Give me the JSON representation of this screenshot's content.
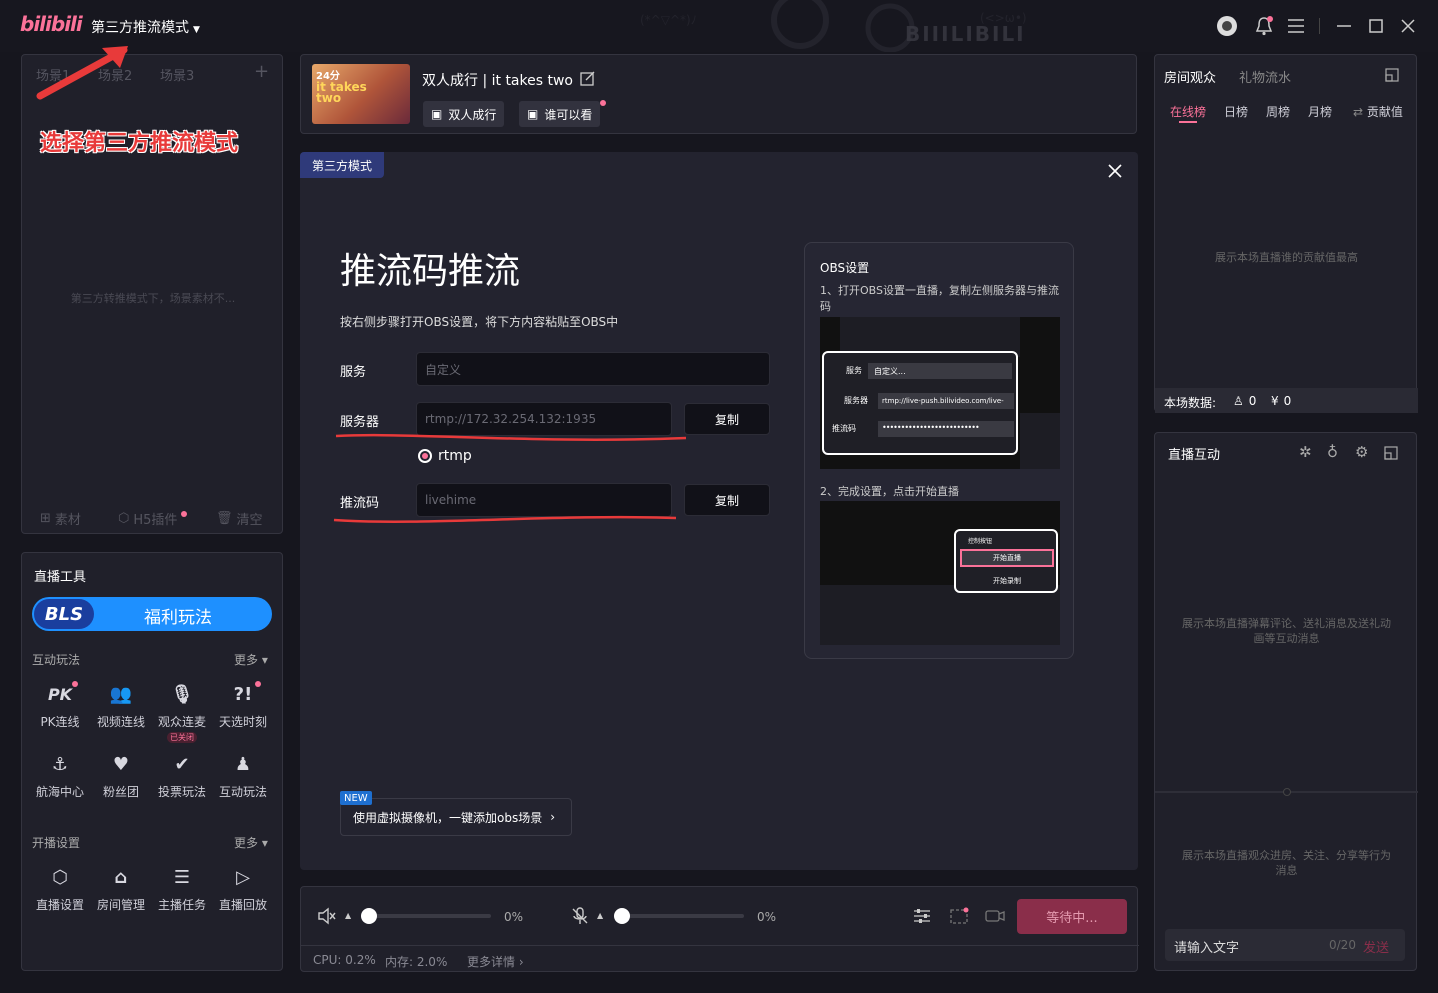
{
  "titlebar": {
    "logo": "bilibili",
    "mode_label": "第三方推流模式",
    "watermark": "BIIILIBILI"
  },
  "annotation": {
    "text": "选择第三方推流模式",
    "color": "#e83a3a"
  },
  "scenes": {
    "tabs": [
      "场景1",
      "场景2",
      "场景3"
    ],
    "add_label": "+",
    "empty_text": "第三方转推模式下，场景素材不...",
    "footer": {
      "material": "素材",
      "h5": "H5插件",
      "clear": "清空"
    }
  },
  "tools": {
    "title": "直播工具",
    "banner": {
      "brand": "BLS",
      "label": "福利玩法"
    },
    "interactive": {
      "title": "互动玩法",
      "more": "更多",
      "items": [
        {
          "label": "PK连线",
          "icon": "pk-icon"
        },
        {
          "label": "视频连线",
          "icon": "video-link-icon"
        },
        {
          "label": "观众连麦",
          "icon": "mic-icon",
          "badge": "已关闭"
        },
        {
          "label": "天选时刻",
          "icon": "lottery-icon"
        },
        {
          "label": "航海中心",
          "icon": "anchor-icon"
        },
        {
          "label": "粉丝团",
          "icon": "fans-icon"
        },
        {
          "label": "投票玩法",
          "icon": "vote-icon"
        },
        {
          "label": "互动玩法",
          "icon": "interactive-icon"
        }
      ]
    },
    "broadcast": {
      "title": "开播设置",
      "more": "更多",
      "items": [
        {
          "label": "直播设置",
          "icon": "settings-icon"
        },
        {
          "label": "房间管理",
          "icon": "room-icon"
        },
        {
          "label": "主播任务",
          "icon": "task-icon"
        },
        {
          "label": "直播回放",
          "icon": "replay-icon"
        }
      ]
    }
  },
  "game": {
    "thumb_tag": "24分",
    "thumb_title": "it takes two",
    "title": "双人成行 | it takes two",
    "category": "双人成行",
    "visibility": "谁可以看"
  },
  "modal": {
    "tag": "第三方模式",
    "title": "推流码推流",
    "description": "按右侧步骤打开OBS设置，将下方内容粘贴至OBS中",
    "service": {
      "label": "服务",
      "value": "自定义"
    },
    "server": {
      "label": "服务器",
      "value": "rtmp://172.32.254.132:1935",
      "copy": "复制"
    },
    "protocol": "rtmp",
    "stream_key": {
      "label": "推流码",
      "value": "livehime",
      "copy": "复制"
    },
    "new_badge": "NEW",
    "virtual_cam": "使用虚拟摄像机，一键添加obs场景",
    "obs": {
      "title": "OBS设置",
      "step1": "1、打开OBS设置一直播，复制左侧服务器与推流码",
      "step1_fields": {
        "service_label": "服务",
        "service_value": "自定义...",
        "server_label": "服务器",
        "server_value": "rtmp://live-push.bilivideo.com/live-",
        "key_label": "推流码"
      },
      "step2": "2、完成设置，点击开始直播",
      "step2_menu": {
        "title": "控制按钮",
        "start": "开始直播",
        "record": "开始录制"
      }
    }
  },
  "controls": {
    "speaker_level": "0%",
    "mic_level": "0%",
    "speaker_fraction": 0.0,
    "mic_fraction": 0.0,
    "wait_button": "等待中...",
    "cpu": "CPU: 0.2%",
    "memory": "内存: 2.0%",
    "more": "更多详情"
  },
  "audience": {
    "tab_audience": "房间观众",
    "tab_gifts": "礼物流水",
    "subtabs": [
      "在线榜",
      "日榜",
      "周榜",
      "月榜",
      "贡献值"
    ],
    "empty": "展示本场直播谁的贡献值最高",
    "stats_label": "本场数据:",
    "viewers": "0",
    "revenue": "0"
  },
  "interact": {
    "title": "直播互动",
    "empty_top": "展示本场直播弹幕评论、送礼消息及送礼动画等互动消息",
    "empty_bottom": "展示本场直播观众进房、关注、分享等行为消息",
    "input_placeholder": "请输入文字",
    "counter": "0/20",
    "send": "发送"
  },
  "colors": {
    "accent": "#fb7299",
    "bls_blue": "#1e90ff",
    "wait_button": "#8a2e4a"
  }
}
